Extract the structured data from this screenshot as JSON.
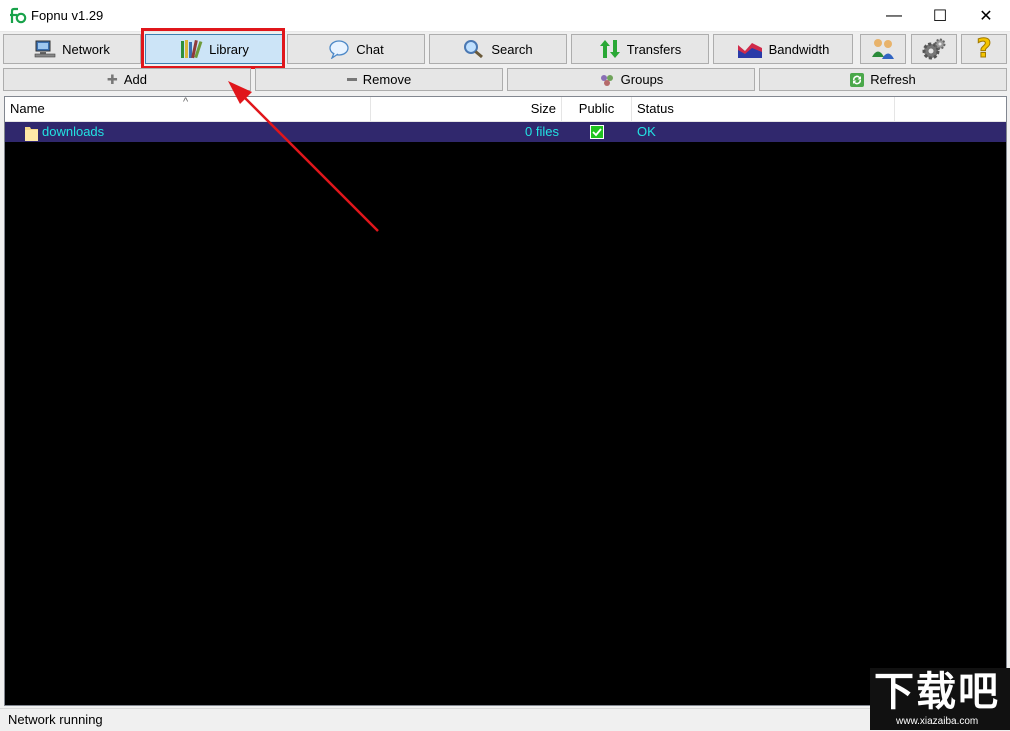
{
  "window": {
    "title": "Fopnu v1.29",
    "minimize_glyph": "—",
    "maximize_glyph": "☐",
    "close_glyph": "✕"
  },
  "toolbar": {
    "network": "Network",
    "library": "Library",
    "chat": "Chat",
    "search": "Search",
    "transfers": "Transfers",
    "bandwidth": "Bandwidth",
    "help_glyph": "?"
  },
  "actions": {
    "add": "Add",
    "remove": "Remove",
    "groups": "Groups",
    "refresh": "Refresh"
  },
  "table": {
    "sort_glyph": "^",
    "columns": {
      "name": "Name",
      "size": "Size",
      "public": "Public",
      "status": "Status"
    },
    "rows": [
      {
        "name": "downloads",
        "size": "0 files",
        "public": true,
        "status": "OK"
      }
    ]
  },
  "status": {
    "text": "Network running"
  },
  "watermark": {
    "text": "下载吧",
    "url": "www.xiazaiba.com"
  },
  "colors": {
    "selection_row": "#30286d",
    "selection_text": "#22e2e2",
    "highlight_box": "#e0161b",
    "annotation_arrow": "#e0161b"
  }
}
